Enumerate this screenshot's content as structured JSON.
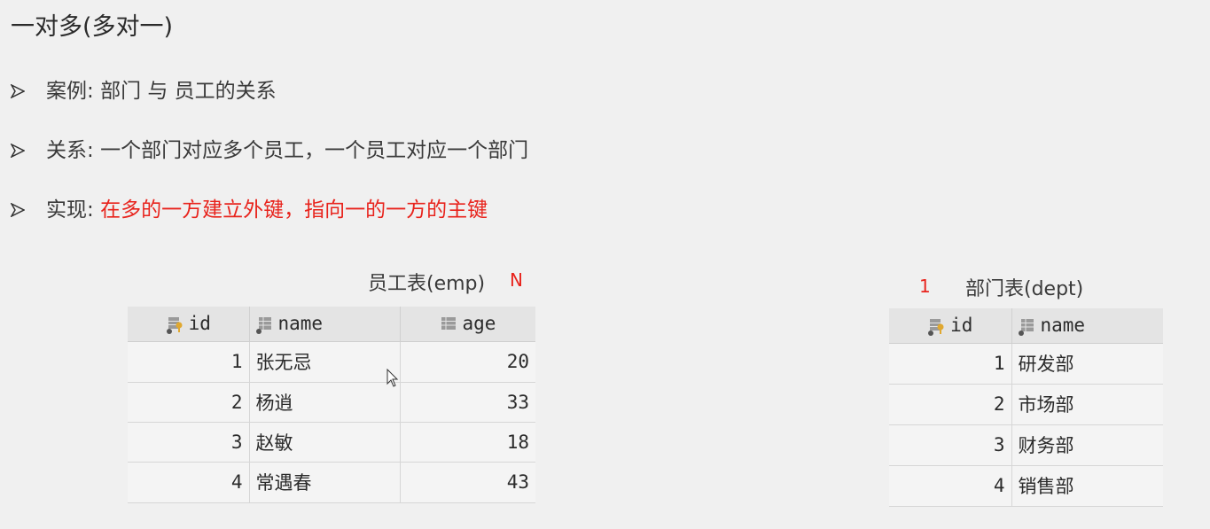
{
  "title": "一对多(多对一)",
  "bullets": [
    {
      "label": "案例: ",
      "text": "部门 与 员工的关系",
      "highlight": ""
    },
    {
      "label": "关系: ",
      "text": "一个部门对应多个员工，一个员工对应一个部门",
      "highlight": ""
    },
    {
      "label": "实现: ",
      "text": "",
      "highlight": "在多的一方建立外键，指向一的一方的主键"
    }
  ],
  "emp": {
    "caption": "员工表(emp)",
    "cardinality": "N",
    "columns": [
      "id",
      "name",
      "age"
    ],
    "rows": [
      {
        "id": "1",
        "name": "张无忌",
        "age": "20"
      },
      {
        "id": "2",
        "name": "杨逍",
        "age": "33"
      },
      {
        "id": "3",
        "name": "赵敏",
        "age": "18"
      },
      {
        "id": "4",
        "name": "常遇春",
        "age": "43"
      }
    ]
  },
  "dept": {
    "caption": "部门表(dept)",
    "cardinality": "1",
    "columns": [
      "id",
      "name"
    ],
    "rows": [
      {
        "id": "1",
        "name": "研发部"
      },
      {
        "id": "2",
        "name": "市场部"
      },
      {
        "id": "3",
        "name": "财务部"
      },
      {
        "id": "4",
        "name": "销售部"
      }
    ]
  },
  "icons": {
    "bullet": "arrowhead-bullet-icon",
    "primary_key_column": "key-column-icon",
    "column": "table-column-icon",
    "cursor": "mouse-pointer-icon"
  },
  "colors": {
    "highlight": "#e8231c",
    "background": "#f0f0f0",
    "table_header": "#e4e4e4"
  }
}
